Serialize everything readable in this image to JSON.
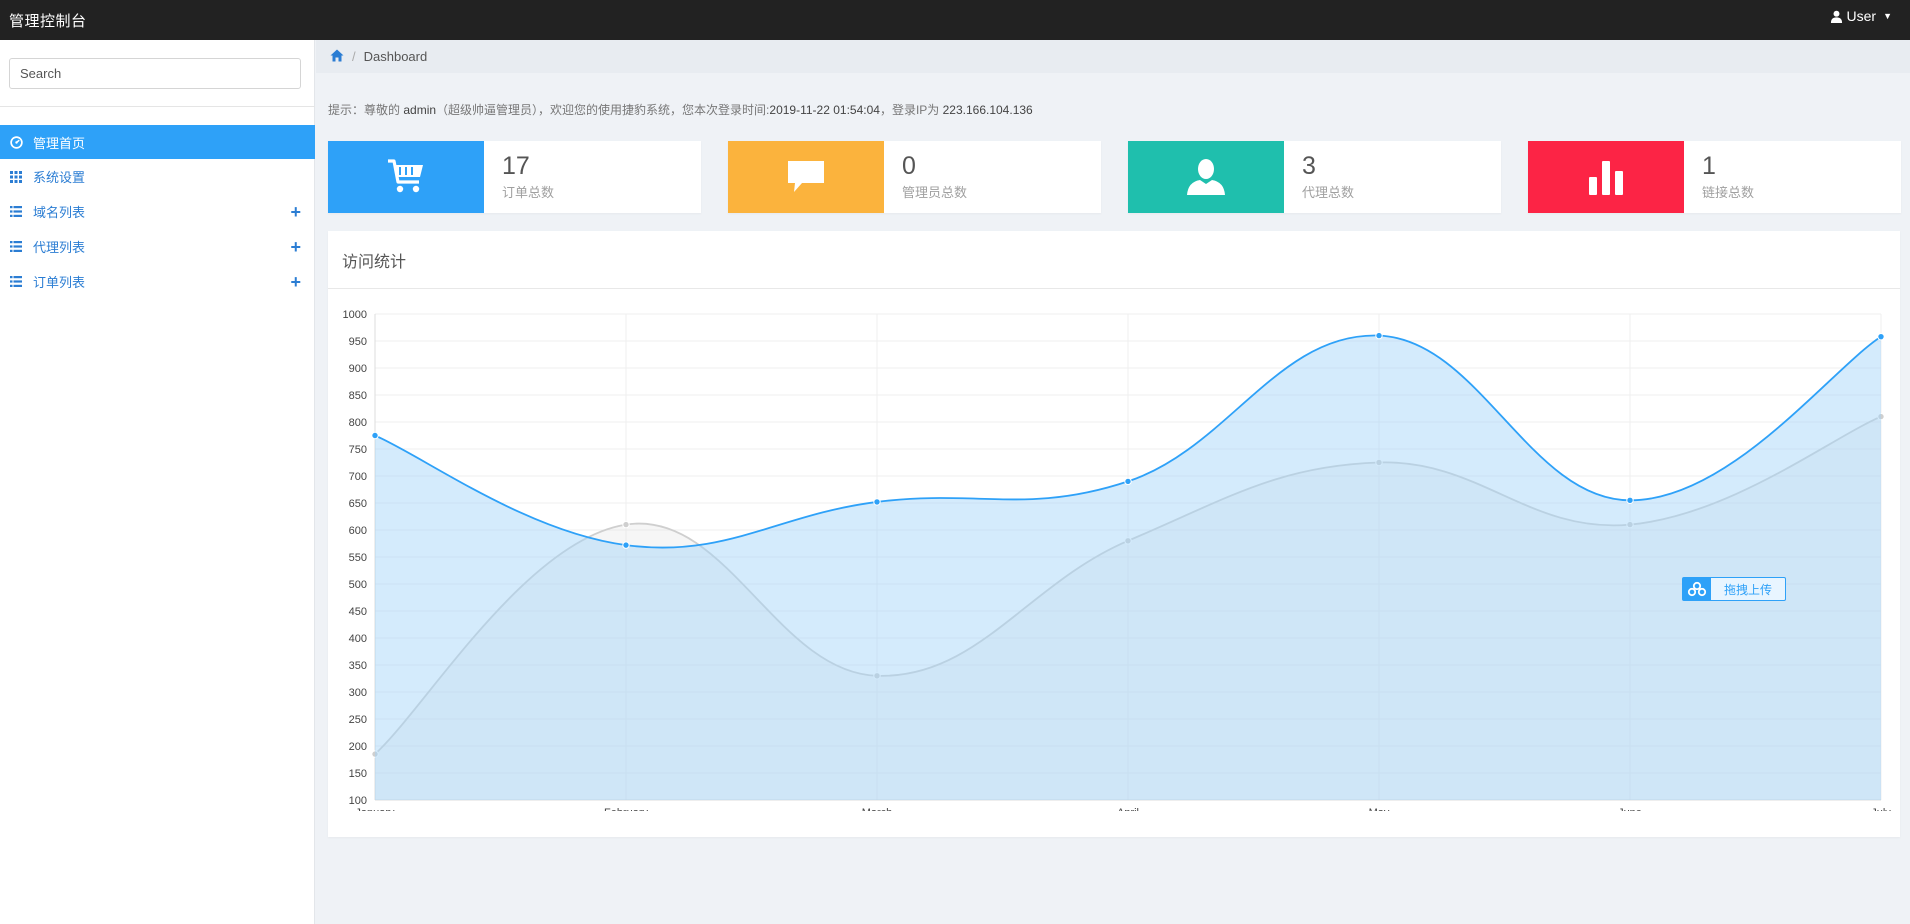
{
  "navbar": {
    "brand": "管理控制台",
    "user_label": "User"
  },
  "sidebar": {
    "search_placeholder": "Search",
    "items": [
      {
        "label": "管理首页",
        "icon": "dashboard-icon",
        "active": true,
        "expandable": false
      },
      {
        "label": "系统设置",
        "icon": "grid-icon",
        "active": false,
        "expandable": false
      },
      {
        "label": "域名列表",
        "icon": "list-icon",
        "active": false,
        "expandable": true
      },
      {
        "label": "代理列表",
        "icon": "list-icon",
        "active": false,
        "expandable": true
      },
      {
        "label": "订单列表",
        "icon": "list-icon",
        "active": false,
        "expandable": true
      }
    ],
    "expand_glyph": "+"
  },
  "breadcrumb": {
    "home_icon": "home-icon",
    "separator": "/",
    "current": "Dashboard"
  },
  "notice": {
    "prefix": "提示：尊敬的 ",
    "username": "admin",
    "role": "（超级帅逼管理员）",
    "middle": "，欢迎您的使用捷豹系统，您本次登录时间:",
    "login_time": "2019-11-22 01:54:04",
    "ip_prefix": "，登录IP为 ",
    "ip": "223.166.104.136"
  },
  "stats": [
    {
      "value": "17",
      "label": "订单总数",
      "icon": "cart-icon",
      "color": "#2ea1f8"
    },
    {
      "value": "0",
      "label": "管理员总数",
      "icon": "comment-icon",
      "color": "#fbb33d"
    },
    {
      "value": "3",
      "label": "代理总数",
      "icon": "user-icon",
      "color": "#1fbfad"
    },
    {
      "value": "1",
      "label": "链接总数",
      "icon": "bar-chart-icon",
      "color": "#fc2445"
    }
  ],
  "panel": {
    "title": "访问统计"
  },
  "upload_widget": {
    "label": "拖拽上传",
    "icon": "cloud-icon"
  },
  "chart_data": {
    "type": "area",
    "categories": [
      "January",
      "February",
      "March",
      "April",
      "May",
      "June",
      "July"
    ],
    "ylim": [
      100,
      1000
    ],
    "y_ticks": [
      100,
      150,
      200,
      250,
      300,
      350,
      400,
      450,
      500,
      550,
      600,
      650,
      700,
      750,
      800,
      850,
      900,
      950,
      1000
    ],
    "grid": true,
    "series": [
      {
        "values": [
          185,
          610,
          330,
          580,
          725,
          610,
          810
        ],
        "color": "#cfcfcf",
        "fill": "rgba(220,220,220,0.25)"
      },
      {
        "values": [
          775,
          572,
          652,
          690,
          960,
          655,
          958
        ],
        "color": "#2ea1f8",
        "fill": "rgba(160,210,248,0.45)"
      }
    ]
  }
}
